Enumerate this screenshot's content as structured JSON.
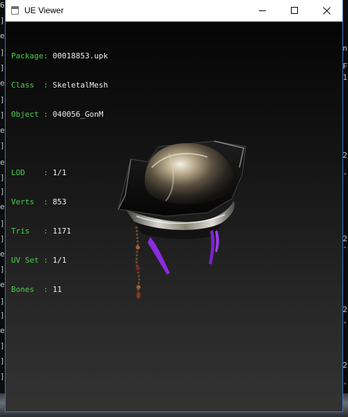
{
  "window": {
    "title": "UE Viewer"
  },
  "info": {
    "package_label": "Package: ",
    "package_value": "00018853.upk",
    "class_label": "Class  : ",
    "class_value": "SkeletalMesh",
    "object_label": "Object : ",
    "object_value": "040056_GonM",
    "lod_label": "LOD    : ",
    "lod_value": "1/1",
    "verts_label": "Verts  : ",
    "verts_value": "853",
    "tris_label": "Tris   : ",
    "tris_value": "1171",
    "uvset_label": "UV Set : ",
    "uvset_value": "1/1",
    "bones_label": "Bones  : ",
    "bones_value": "11"
  },
  "colors": {
    "label": "#4ad04a",
    "value": "#f0f0f0",
    "accent_purple": "#8a2be2"
  },
  "background_console": {
    "left_glyphs": [
      "6",
      "]",
      "e",
      "]",
      "]",
      "e",
      "]",
      "]",
      "e",
      "]",
      "e",
      "]",
      "]",
      "e",
      "]",
      "]",
      "e",
      "]",
      "e",
      "]",
      "]",
      "e",
      "]",
      "]",
      "]"
    ],
    "right_glyphs": [
      "n",
      "F",
      "1",
      "2",
      "-",
      "2",
      "-",
      "2",
      "-",
      "2",
      "-"
    ]
  },
  "icons": {
    "app": "app-window-icon",
    "minimize": "minimize-icon",
    "maximize": "maximize-icon",
    "close": "close-icon"
  }
}
